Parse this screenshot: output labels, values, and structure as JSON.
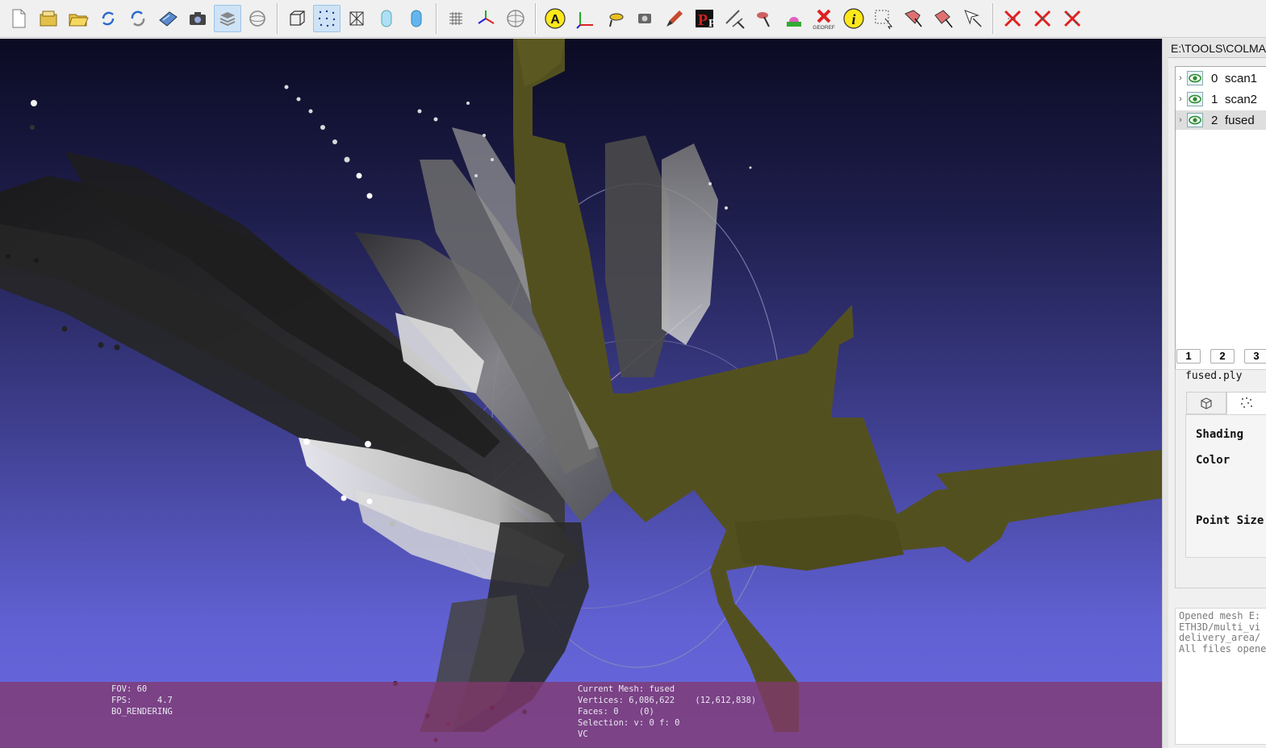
{
  "toolbar": {
    "buttons": [
      {
        "id": "new-project",
        "icon": "new-file-icon"
      },
      {
        "id": "open-project",
        "icon": "open-project-icon"
      },
      {
        "id": "import-mesh",
        "icon": "open-folder-icon"
      },
      {
        "id": "reload",
        "icon": "reload-icon"
      },
      {
        "id": "reload-all",
        "icon": "reload-all-icon"
      },
      {
        "id": "save",
        "icon": "save-icon"
      },
      {
        "id": "snapshot",
        "icon": "camera-icon"
      },
      {
        "id": "layers",
        "icon": "layers-icon",
        "active": true
      },
      {
        "id": "ortho",
        "icon": "ortho-sphere-icon"
      },
      {
        "id": "bbox",
        "icon": "bounding-box-icon"
      },
      {
        "id": "points",
        "icon": "points-icon",
        "active": true
      },
      {
        "id": "wireframe",
        "icon": "wireframe-icon"
      },
      {
        "id": "flat",
        "icon": "flat-shading-icon"
      },
      {
        "id": "smooth",
        "icon": "smooth-shading-icon"
      },
      {
        "id": "lighting",
        "icon": "lighting-icon"
      },
      {
        "id": "axes",
        "icon": "axes-icon"
      },
      {
        "id": "trackball",
        "icon": "trackball-icon"
      },
      {
        "id": "annotate",
        "icon": "annotate-icon",
        "glyph": "A"
      },
      {
        "id": "manipulator",
        "icon": "manipulator-icon"
      },
      {
        "id": "paint-roller",
        "icon": "paint-roller-icon"
      },
      {
        "id": "raster-align",
        "icon": "raster-align-icon"
      },
      {
        "id": "brush",
        "icon": "brush-icon"
      },
      {
        "id": "pick-points",
        "icon": "pick-points-icon",
        "glyph": "P"
      },
      {
        "id": "measure",
        "icon": "measure-icon"
      },
      {
        "id": "align",
        "icon": "align-icon"
      },
      {
        "id": "paint",
        "icon": "paint-icon"
      },
      {
        "id": "georef",
        "icon": "georef-icon",
        "label": "GEOREF"
      },
      {
        "id": "info",
        "icon": "info-icon",
        "glyph": "i"
      },
      {
        "id": "select-faces",
        "icon": "select-faces-icon"
      },
      {
        "id": "select-connected",
        "icon": "select-connected-icon"
      },
      {
        "id": "select-vertices",
        "icon": "select-vertices-icon"
      },
      {
        "id": "select-cursor",
        "icon": "select-cursor-icon"
      },
      {
        "id": "delete-faces",
        "icon": "delete-faces-icon"
      },
      {
        "id": "delete-vertices",
        "icon": "delete-vertices-icon"
      },
      {
        "id": "delete-all",
        "icon": "delete-all-icon"
      }
    ]
  },
  "viewport": {
    "info_left": "FOV: 60\nFPS:     4.7\nBO_RENDERING",
    "info_right": "Current Mesh: fused\nVertices: 6,086,622    (12,612,838)\nFaces: 0    (0)\nSelection: v: 0 f: 0\nVC"
  },
  "panel": {
    "path": "E:\\TOOLS\\COLMAP",
    "layers": [
      {
        "index": "0",
        "name": "scan1",
        "selected": false
      },
      {
        "index": "1",
        "name": "scan2",
        "selected": false
      },
      {
        "index": "2",
        "name": "fused",
        "selected": true
      }
    ],
    "view_tabs": [
      "1",
      "2",
      "3"
    ],
    "props_title": "fused.ply",
    "props_tabs": [
      {
        "icon": "box-icon"
      },
      {
        "icon": "points-icon",
        "active": true
      }
    ],
    "labels": {
      "shading": "Shading",
      "color": "Color",
      "point_size": "Point Size"
    }
  },
  "log": {
    "lines": [
      "Opened mesh E:",
      "ETH3D/multi_vi",
      "delivery_area/",
      "All files opened"
    ]
  }
}
